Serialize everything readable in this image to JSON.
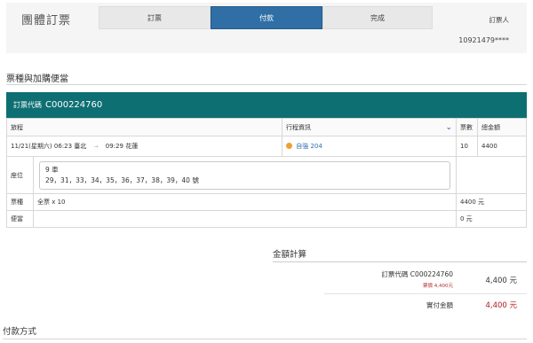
{
  "header": {
    "title": "團體訂票",
    "steps": [
      {
        "label": "訂票",
        "active": false
      },
      {
        "label": "付款",
        "active": true
      },
      {
        "label": "完成",
        "active": false
      }
    ],
    "booker_label": "訂票人",
    "booker_id": "10921479****"
  },
  "section": {
    "title": "票種與加購便當"
  },
  "order": {
    "label": "訂票代碼",
    "code": "C000224760"
  },
  "table": {
    "headers": {
      "route": "旅程",
      "trip_info": "行程資訊",
      "tickets": "票數",
      "total": "總金額"
    },
    "route": {
      "date": "11/21(星期六)",
      "depart_time": "06:23",
      "from": "臺北",
      "arrive_time": "09:29",
      "to": "花蓮",
      "train": "自強 204",
      "tickets": "10",
      "total": "4400"
    },
    "seat": {
      "label": "座位",
      "car": "9 車",
      "numbers": "29，31，33，34，35，36，37，38，39，40 號"
    },
    "ticket_type": {
      "label": "票種",
      "value": "全票 x 10",
      "amount": "4400 元"
    },
    "bento": {
      "label": "便當",
      "value": "",
      "amount": "0 元"
    }
  },
  "summary": {
    "title": "金額計算",
    "order_line": "訂票代碼 C000224760",
    "fare_line": "票價 4,400元",
    "order_amount": "4,400 元",
    "payable_label": "實付金額",
    "payable_amount": "4,400 元"
  },
  "payment": {
    "title": "付款方式"
  },
  "colors": {
    "accent": "#2f6fa6",
    "order_bar": "#0e6f73",
    "price_red": "#b01818"
  }
}
